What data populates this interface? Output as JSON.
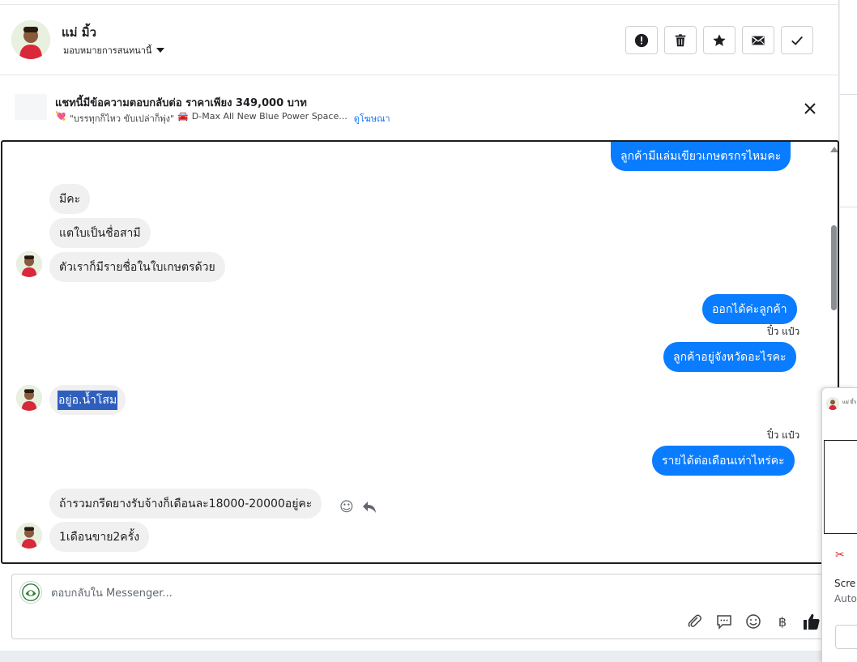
{
  "header": {
    "contact_name": "แม่ มิ้ว",
    "assign_label": "มอบหมายการสนทนานี้",
    "actions": [
      "report-spam",
      "delete",
      "star",
      "mark-unread",
      "mark-done"
    ]
  },
  "promo": {
    "title": "แชทนี้มีข้อความตอบกลับต่อ ราคาเพียง 349,000 บาท",
    "emoji_left": "💘",
    "description": "\"บรรทุกก็ไหว ขับเปล่าก็พุ่ง\"",
    "emoji_car": "🚘",
    "description2": "D-Max All New Blue Power Space...",
    "link_label": "ดูโฆษณา"
  },
  "messages": {
    "m1": "ลูกค้ามีแล่มเขียวเกษตรกรไหมคะ",
    "m2": "มีคะ",
    "m3": "แตใบเป็นชื่อสามี",
    "m4": "ตัวเราก็มีรายชื่อในใบเกษตรด้วย",
    "m5": "ออกได้ค่ะลูกค้า",
    "s1": "ปิ๋ว แป๋ว",
    "m6": "ลูกค้าอยู่จังหวัดอะไรคะ",
    "m7": "อยู่อ.น้ำโสม",
    "s2": "ปิ๋ว แป๋ว",
    "m8": "รายได้ต่อเดือนเท่าไหร่คะ",
    "m9": "ถ้ารวมกรีดยางรับจ้างก็เดือนละ18000-20000อยู่คะ",
    "m10": "1เดือนขาย2ครั้ง"
  },
  "composer": {
    "placeholder": "ตอบกลับใน Messenger...",
    "baht_symbol": "฿"
  },
  "overlay": {
    "mini_title": "แม่ มิ้ว",
    "line1": "Scre",
    "line2": "Auto"
  },
  "colors": {
    "outgoing": "#0a7cff",
    "incoming": "#f0f0f0",
    "selection": "#2f5fbd",
    "link": "#1877f2"
  }
}
